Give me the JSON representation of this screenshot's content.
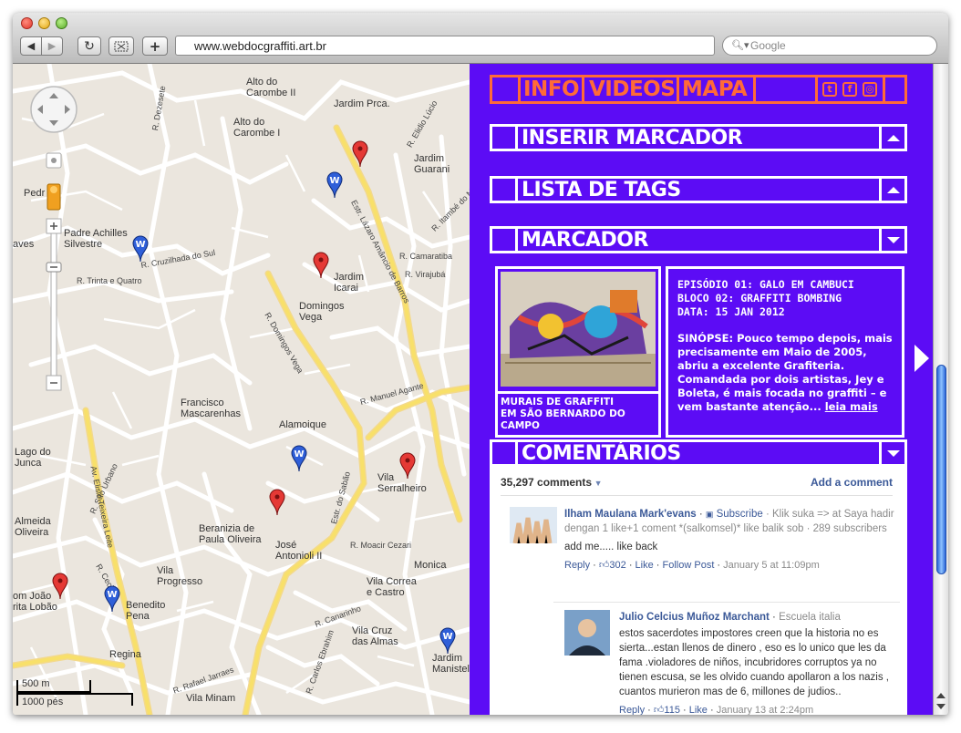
{
  "browser": {
    "url": "www.webdocgraffiti.art.br",
    "search_placeholder": "Google",
    "buttons": {
      "back": "◀",
      "forward": "▶",
      "reload": "↻",
      "new_tab": "+"
    }
  },
  "map": {
    "scale_metric": "500 m",
    "scale_imperial": "1000 pés",
    "labels": {
      "carombe2": "Alto do\nCarombe II",
      "jardim_prca": "Jardim Prca.",
      "carombe1": "Alto do\nCarombe I",
      "jardim_guarani": "Jardim\nGuarani",
      "pedra": "Pedr",
      "achilles": "Padre Achilles\nSilvestre",
      "aves": "aves",
      "jardim_icarai": "Jardim\nIcarai",
      "domingos_vega": "Domingos\nVega",
      "francisco": "Francisco\nMascarenhas",
      "alamoique": "Alamoique",
      "lago_junca": "Lago do\nJunca",
      "vila_serralheiro": "Vila\nSerralheiro",
      "almeida": "Almeida\nOliveira",
      "beranizia": "Beranizia de\nPaula Oliveira",
      "jose_antonioli": "José\nAntonioli II",
      "vila_progresso": "Vila\nProgresso",
      "monica": "Monica",
      "correa": "Vila Correa\ne Castro",
      "joao_lobao": "om João\nrita Lobão",
      "benedito": "Benedito\nPena",
      "regina": "Regina",
      "vila_cruz": "Vila Cruz\ndas Almas",
      "vila_minam": "Vila Minam",
      "jardim_manistela": "Jardim\nManistela"
    },
    "streets": {
      "s1": "R. Dezesete",
      "s2": "R. Elidio Lúcio",
      "s3": "Estr. Lázaro Amâncio de Barros",
      "s4": "R. Domingos Vega",
      "s5": "R. Trinta e Quatro",
      "s6": "R. Cruzilhada do Sul",
      "s7": "Av. Elisio Teixeira Leite",
      "s8": "Estr. do Sabão",
      "s9": "R. Manuel Agante",
      "s10": "R. Moacir Cezari",
      "s11": "R. Canarinho",
      "s12": "R. Itambé do Mato",
      "s13": "R. Camaratiba",
      "s14": "R. Virajubá",
      "s15": "R. São Urbano",
      "s16": "R. Cecilia",
      "s17": "R. Rafael Jarraes",
      "s18": "R. Carlos Ebrahim"
    }
  },
  "panel": {
    "nav": {
      "info": "INFO",
      "videos": "VIDEOS",
      "mapa": "MAPA"
    },
    "social_icons": [
      "twitter-icon",
      "facebook-icon",
      "instagram-icon"
    ],
    "sections": {
      "inserir": "INSERIR MARCADOR",
      "tags": "LISTA DE TAGS",
      "marcador": "MARCADOR",
      "comentarios": "COMENTÁRIOS"
    },
    "marker": {
      "image_caption": "MURAIS DE GRAFFITI\nEM SÃO BERNARDO DO\nCAMPO",
      "episode": "EPISÓDIO 01: GALO EM CAMBUCI",
      "block": "BLOCO 02: GRAFFITI BOMBING",
      "date": "DATA: 15 JAN 2012",
      "synopsis": "SINÓPSE: Pouco tempo depois, mais precisamente em Maio de 2005, abriu a excelente Grafiteria. Comandada por dois artistas, Jey e Boleta, é mais focada no graffiti – e vem bastante atenção...",
      "read_more": "leia mais"
    },
    "comments": {
      "count": "35,297 comments",
      "add": "Add a comment",
      "items": [
        {
          "author": "Ilham Maulana Mark'evans",
          "subscribe": "Subscribe",
          "meta": "· Klik suka => at Saya hadir dengan 1 like+1 coment *(salkomsel)* like balik sob · 289 subscribers",
          "text": "add me..... like back",
          "reply": "Reply",
          "likes": "302",
          "like": "Like",
          "follow": "Follow Post",
          "date": "January 5 at 11:09pm"
        },
        {
          "author": "Julio Celcius Muñoz Marchant",
          "meta": "Escuela italia",
          "text": "estos sacerdotes impostores creen que la historia no es sierta...estan llenos de dinero , eso es lo unico que les da fama .violadores de niños, incubridores corruptos ya no tienen escusa, se les olvido cuando apollaron a los nazis , cuantos murieron mas de 6, millones de judios..",
          "reply": "Reply",
          "likes": "115",
          "like": "Like",
          "date": "January 13 at 2:24pm"
        }
      ]
    }
  }
}
